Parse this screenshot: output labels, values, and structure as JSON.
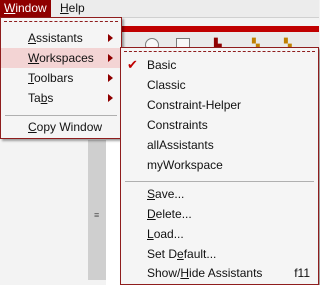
{
  "menubar": {
    "window_label": "Window",
    "window_mnemonic_rest": "indow",
    "window_mnemonic": "W",
    "help_mnemonic": "H",
    "help_mnemonic_rest": "elp"
  },
  "window_menu": {
    "items": [
      {
        "mn": "A",
        "rest": "ssistants",
        "has_submenu": true
      },
      {
        "mn": "W",
        "rest": "orkspaces",
        "has_submenu": true
      },
      {
        "mn": "T",
        "rest": "oolbars",
        "has_submenu": true
      },
      {
        "pre": "Ta",
        "mn": "b",
        "rest": "s",
        "has_submenu": true
      },
      {
        "mn": "C",
        "rest": "opy Window",
        "has_submenu": false
      }
    ]
  },
  "workspaces_menu": {
    "items": [
      {
        "label": "Basic",
        "checked": true
      },
      {
        "label": "Classic"
      },
      {
        "label": "Constraint-Helper"
      },
      {
        "label": "Constraints"
      },
      {
        "label": "allAssistants"
      },
      {
        "label": "myWorkspace"
      }
    ],
    "actions": [
      {
        "pre": "",
        "mn": "S",
        "rest": "ave..."
      },
      {
        "pre": "",
        "mn": "D",
        "rest": "elete..."
      },
      {
        "pre": "",
        "mn": "L",
        "rest": "oad..."
      },
      {
        "pre": "Set D",
        "mn": "e",
        "rest": "fault..."
      },
      {
        "pre": "Show/",
        "mn": "H",
        "rest": "ide Assistants",
        "shortcut": "f11"
      }
    ]
  },
  "colors": {
    "accent": "#8f0000",
    "highlight": "#f3d4d4",
    "check": "#c00000"
  }
}
